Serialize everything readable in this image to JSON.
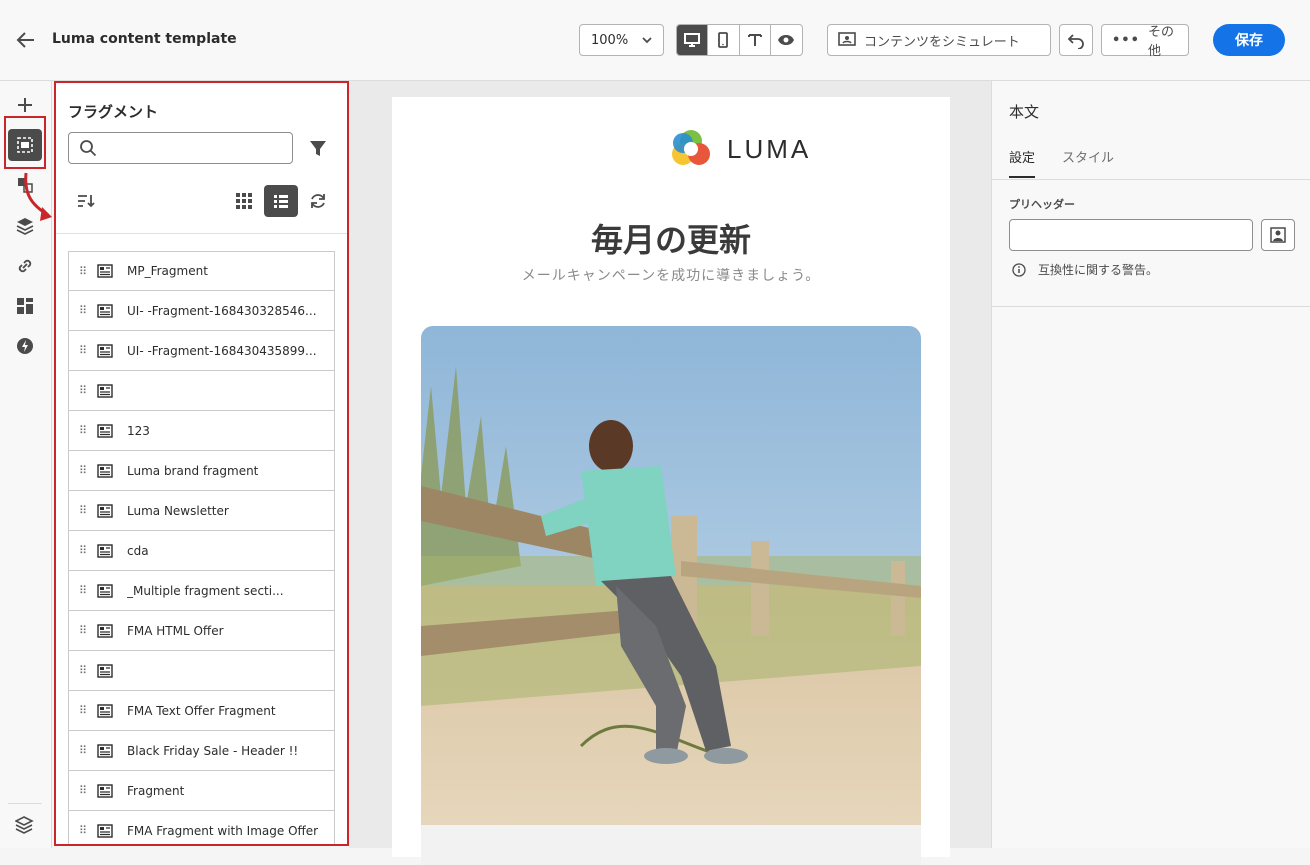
{
  "header": {
    "title": "Luma content template",
    "zoom": "100%",
    "simulate_label": "コンテンツをシミュレート",
    "more_label": "その他",
    "save_label": "保存"
  },
  "fragments_panel": {
    "title": "フラグメント",
    "search_placeholder": "",
    "items": [
      {
        "label": "MP_Fragment"
      },
      {
        "label": "UI-       -Fragment-168430328546..."
      },
      {
        "label": "UI-       -Fragment-168430435899..."
      },
      {
        "label": ""
      },
      {
        "label": "                   123"
      },
      {
        "label": "Luma brand fragment"
      },
      {
        "label": "Luma Newsletter"
      },
      {
        "label": "      cda"
      },
      {
        "label": "          _Multiple fragment secti..."
      },
      {
        "label": "FMA HTML Offer"
      },
      {
        "label": ""
      },
      {
        "label": "FMA Text Offer Fragment"
      },
      {
        "label": "Black Friday Sale - Header !!"
      },
      {
        "label": "         Fragment"
      },
      {
        "label": "FMA Fragment with Image Offer"
      }
    ]
  },
  "email": {
    "logo_text": "LUMA",
    "headline": "毎月の更新",
    "subline": "メールキャンペーンを成功に導きましょう。"
  },
  "properties_panel": {
    "title": "本文",
    "tabs": [
      "設定",
      "スタイル"
    ],
    "preheader_label": "プリヘッダー",
    "preheader_value": "",
    "warning": "互換性に関する警告。"
  },
  "colors": {
    "accent": "#1473e6",
    "highlight": "#c8262b"
  }
}
